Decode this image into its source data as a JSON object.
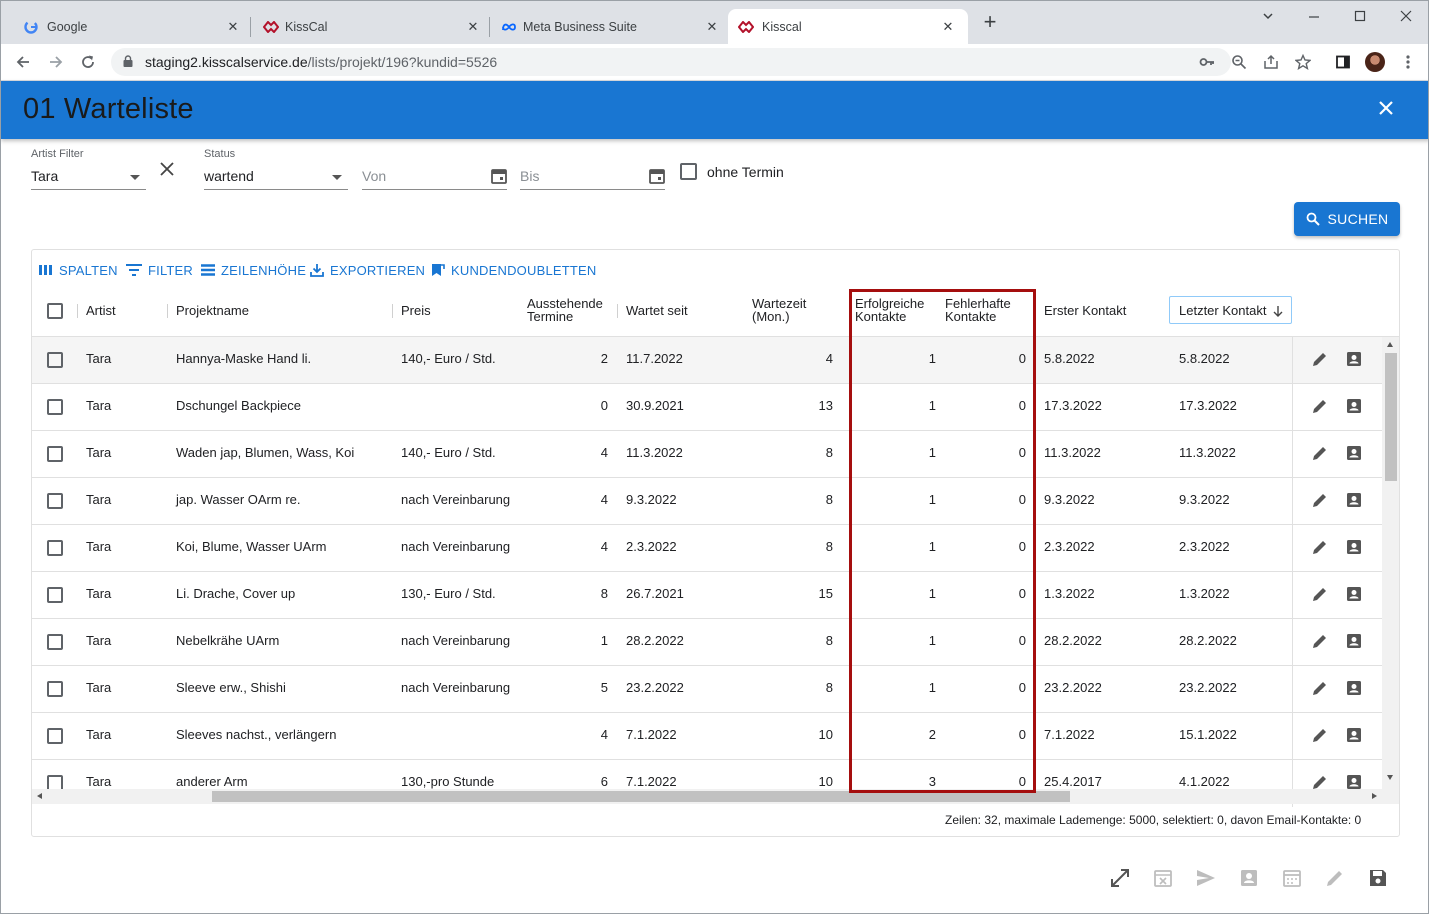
{
  "browser": {
    "tabs": [
      {
        "title": "Google",
        "icon": "google-icon",
        "active": false
      },
      {
        "title": "KissCal",
        "icon": "kisscal-icon",
        "active": false
      },
      {
        "title": "Meta Business Suite",
        "icon": "meta-icon",
        "active": false
      },
      {
        "title": "Kisscal",
        "icon": "kisscal-icon",
        "active": true
      }
    ],
    "url_host": "staging2.kisscalservice.de",
    "url_path": "/lists/projekt/196?kundid=5526"
  },
  "app": {
    "title": "01 Warteliste",
    "accent": "#1976d2",
    "highlight": "#a50e0e"
  },
  "filters": {
    "artist_label": "Artist Filter",
    "artist_value": "Tara",
    "status_label": "Status",
    "status_value": "wartend",
    "von_placeholder": "Von",
    "bis_placeholder": "Bis",
    "ohne_termin_label": "ohne Termin",
    "search_label": "SUCHEN"
  },
  "grid_toolbar": {
    "spalten": "SPALTEN",
    "filter": "FILTER",
    "zeilenhoehe": "ZEILENHÖHE",
    "exportieren": "EXPORTIEREN",
    "kundendoubletten": "KUNDENDOUBLETTEN"
  },
  "columns": {
    "artist": "Artist",
    "projektname": "Projektname",
    "preis": "Preis",
    "ausstehende_1": "Ausstehende",
    "ausstehende_2": "Termine",
    "wartet_seit": "Wartet seit",
    "wartezeit_1": "Wartezeit",
    "wartezeit_2": "(Mon.)",
    "erfolgreiche_1": "Erfolgreiche",
    "erfolgreiche_2": "Kontakte",
    "fehlerhafte_1": "Fehlerhafte",
    "fehlerhafte_2": "Kontakte",
    "erster_kontakt": "Erster Kontakt",
    "letzter_kontakt": "Letzter Kontakt"
  },
  "rows": [
    {
      "artist": "Tara",
      "projekt": "Hannya-Maske Hand li.",
      "preis": "140,- Euro / Std.",
      "termine": "2",
      "seit": "11.7.2022",
      "monate": "4",
      "erfolg": "1",
      "fehler": "0",
      "erster": "5.8.2022",
      "letzter": "5.8.2022"
    },
    {
      "artist": "Tara",
      "projekt": "Dschungel Backpiece",
      "preis": "",
      "termine": "0",
      "seit": "30.9.2021",
      "monate": "13",
      "erfolg": "1",
      "fehler": "0",
      "erster": "17.3.2022",
      "letzter": "17.3.2022"
    },
    {
      "artist": "Tara",
      "projekt": "Waden jap, Blumen, Wass, Koi",
      "preis": "140,- Euro / Std.",
      "termine": "4",
      "seit": "11.3.2022",
      "monate": "8",
      "erfolg": "1",
      "fehler": "0",
      "erster": "11.3.2022",
      "letzter": "11.3.2022"
    },
    {
      "artist": "Tara",
      "projekt": "jap. Wasser OArm re.",
      "preis": "nach Vereinbarung",
      "termine": "4",
      "seit": "9.3.2022",
      "monate": "8",
      "erfolg": "1",
      "fehler": "0",
      "erster": "9.3.2022",
      "letzter": "9.3.2022"
    },
    {
      "artist": "Tara",
      "projekt": "Koi, Blume, Wasser UArm",
      "preis": "nach Vereinbarung",
      "termine": "4",
      "seit": "2.3.2022",
      "monate": "8",
      "erfolg": "1",
      "fehler": "0",
      "erster": "2.3.2022",
      "letzter": "2.3.2022"
    },
    {
      "artist": "Tara",
      "projekt": "Li. Drache, Cover up",
      "preis": "130,- Euro / Std.",
      "termine": "8",
      "seit": "26.7.2021",
      "monate": "15",
      "erfolg": "1",
      "fehler": "0",
      "erster": "1.3.2022",
      "letzter": "1.3.2022"
    },
    {
      "artist": "Tara",
      "projekt": "Nebelkrähe UArm",
      "preis": "nach Vereinbarung",
      "termine": "1",
      "seit": "28.2.2022",
      "monate": "8",
      "erfolg": "1",
      "fehler": "0",
      "erster": "28.2.2022",
      "letzter": "28.2.2022"
    },
    {
      "artist": "Tara",
      "projekt": "Sleeve erw., Shishi",
      "preis": "nach Vereinbarung",
      "termine": "5",
      "seit": "23.2.2022",
      "monate": "8",
      "erfolg": "1",
      "fehler": "0",
      "erster": "23.2.2022",
      "letzter": "23.2.2022"
    },
    {
      "artist": "Tara",
      "projekt": "Sleeves nachst., verlängern",
      "preis": "",
      "termine": "4",
      "seit": "7.1.2022",
      "monate": "10",
      "erfolg": "2",
      "fehler": "0",
      "erster": "7.1.2022",
      "letzter": "15.1.2022"
    },
    {
      "artist": "Tara",
      "projekt": "anderer Arm",
      "preis": "130,-pro Stunde",
      "termine": "6",
      "seit": "7.1.2022",
      "monate": "10",
      "erfolg": "3",
      "fehler": "0",
      "erster": "25.4.2017",
      "letzter": "4.1.2022"
    }
  ],
  "footer": {
    "status": "Zeilen: 32, maximale Lademenge: 5000, selektiert: 0, davon Email-Kontakte: 0"
  }
}
